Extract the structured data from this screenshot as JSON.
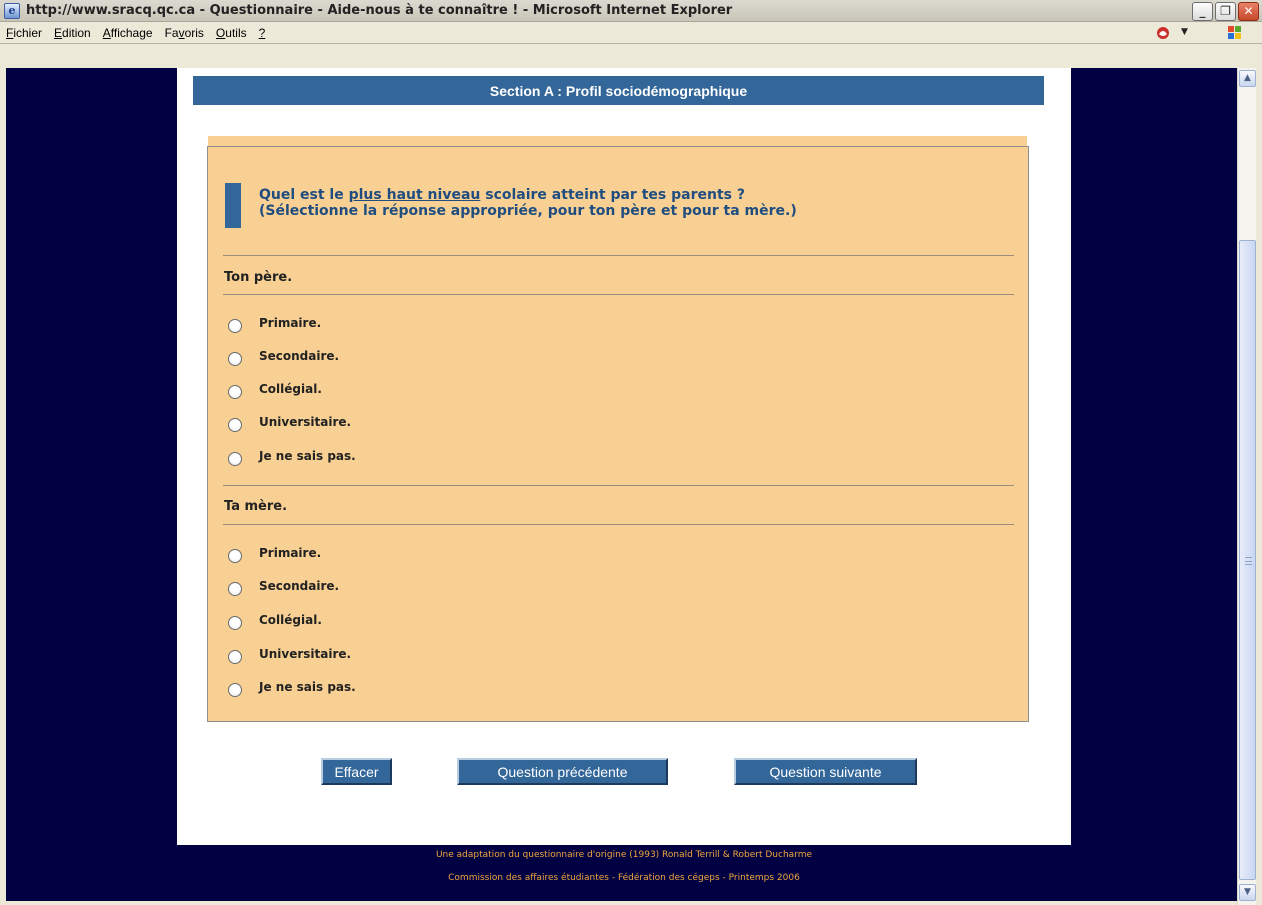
{
  "window": {
    "title": "http://www.sracq.qc.ca - Questionnaire - Aide-nous à te connaître ! - Microsoft Internet Explorer",
    "buttons": {
      "minimize": "_",
      "restore": "❐",
      "close": "✕"
    }
  },
  "menubar": {
    "items": [
      {
        "label": "Fichier",
        "accesskey": "F"
      },
      {
        "label": "Edition",
        "accesskey": "E"
      },
      {
        "label": "Affichage",
        "accesskey": "A"
      },
      {
        "label": "Favoris",
        "accesskey": "v"
      },
      {
        "label": "Outils",
        "accesskey": "O"
      },
      {
        "label": "?",
        "accesskey": "?"
      }
    ]
  },
  "page": {
    "section_title": "Section A : Profil sociodémographique",
    "question": {
      "prefix": "Quel est le ",
      "emphasis": "plus haut niveau",
      "suffix": " scolaire atteint par tes parents ?",
      "instruction": "(Sélectionne la réponse appropriée, pour ton père et pour ta mère.)"
    },
    "groups": [
      {
        "label": "Ton père.",
        "options": [
          "Primaire.",
          "Secondaire.",
          "Collégial.",
          "Universitaire.",
          "Je ne sais pas."
        ]
      },
      {
        "label": "Ta mère.",
        "options": [
          "Primaire.",
          "Secondaire.",
          "Collégial.",
          "Universitaire.",
          "Je ne sais pas."
        ]
      }
    ],
    "buttons": {
      "clear": "Effacer",
      "previous": "Question précédente",
      "next": "Question suivante"
    },
    "footer": {
      "line1": "Une adaptation du questionnaire d'origine (1993) Ronald Terrill & Robert Ducharme",
      "line2": "Commission des affaires étudiantes - Fédération des cégeps - Printemps 2006"
    }
  },
  "colors": {
    "sidebar": "#000043",
    "header": "#336699",
    "panel": "#f9d093",
    "question_text": "#1f4d80",
    "footer_text": "#f0a53c"
  }
}
